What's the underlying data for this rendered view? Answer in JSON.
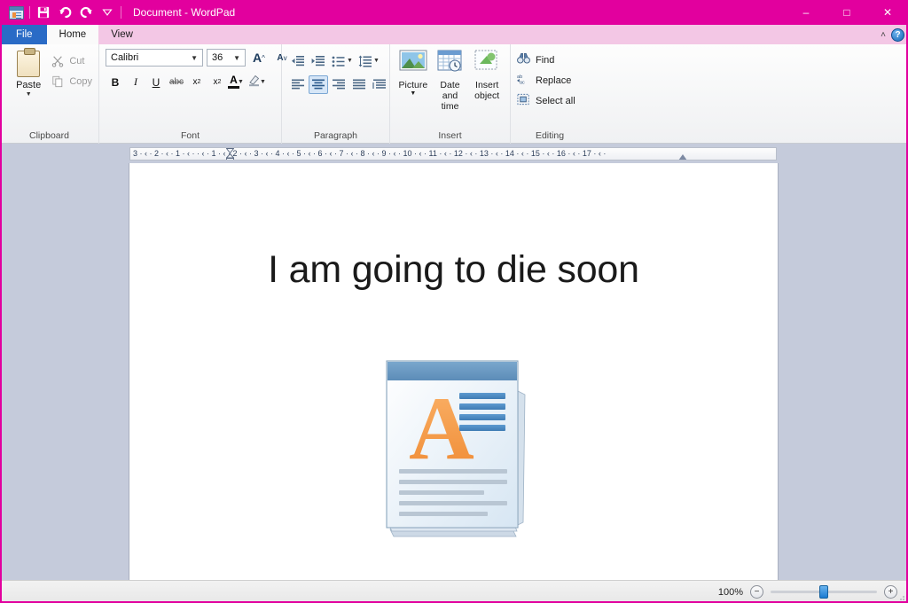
{
  "window": {
    "title": "Document - WordPad",
    "accent_color": "#E2009E",
    "quick_access": [
      {
        "name": "app-icon",
        "label": "WordPad"
      },
      {
        "name": "save-icon",
        "label": "Save"
      },
      {
        "name": "undo-icon",
        "label": "Undo"
      },
      {
        "name": "redo-icon",
        "label": "Redo"
      },
      {
        "name": "customize-qat-icon",
        "label": "Customize Quick Access Toolbar"
      }
    ],
    "controls": {
      "minimize": "–",
      "maximize": "□",
      "close": "✕"
    }
  },
  "tabs": [
    {
      "label": "File",
      "state": "file"
    },
    {
      "label": "Home",
      "state": "active"
    },
    {
      "label": "View",
      "state": "normal"
    }
  ],
  "tab_right": {
    "collapse": "˄",
    "help": "?"
  },
  "ribbon": {
    "clipboard": {
      "label": "Clipboard",
      "paste": {
        "label": "Paste",
        "arrow": "▼"
      },
      "cut": "Cut",
      "copy": "Copy"
    },
    "font": {
      "label": "Font",
      "family_value": "Calibri",
      "size_value": "36",
      "grow": "A",
      "shrink": "A",
      "bold": "B",
      "italic": "I",
      "underline": "U",
      "strikethrough": "abc",
      "subscript": "x",
      "superscript": "x",
      "text_color": "A",
      "highlight": "✎",
      "dropdown": "▼"
    },
    "paragraph": {
      "label": "Paragraph",
      "decrease_indent": "←",
      "increase_indent": "→",
      "bullets": "≡",
      "line_spacing": "≣",
      "align_left": "left",
      "align_center": "center",
      "align_right": "right",
      "justify": "justify",
      "paragraph_settings": "settings",
      "dropdown": "▼"
    },
    "insert": {
      "label": "Insert",
      "picture": "Picture",
      "picture_arrow": "▼",
      "date_time": "Date and time",
      "insert_object": "Insert object"
    },
    "editing": {
      "label": "Editing",
      "find": "Find",
      "replace": "Replace",
      "select_all": "Select all"
    }
  },
  "ruler": {
    "left_numbers": "3  ·  ᴵ  ·  2  ·  ᴵ  ·  1  ·  ᴵ  ·",
    "ticks_text": "3 · ‹ · 2 · ‹ · 1 · ‹ ·      · ‹ · 1 · ‹ · 2 · ‹ · 3 · ‹ · 4 · ‹ · 5 · ‹ · 6 · ‹ · 7 · ‹ · 8 · ‹ · 9 · ‹ · 10 · ‹ · 11 · ‹ · 12 · ‹ · 13 · ‹ · 14 · ‹ · 15 · ‹ · 16 · ‹ · 17 · ‹ ·"
  },
  "document": {
    "text": "I am going to die soon",
    "image_name": "wordpad-document-logo",
    "image_letter": "A"
  },
  "status": {
    "zoom_label": "100%",
    "zoom_out": "−",
    "zoom_in": "+",
    "zoom_value": 100
  }
}
